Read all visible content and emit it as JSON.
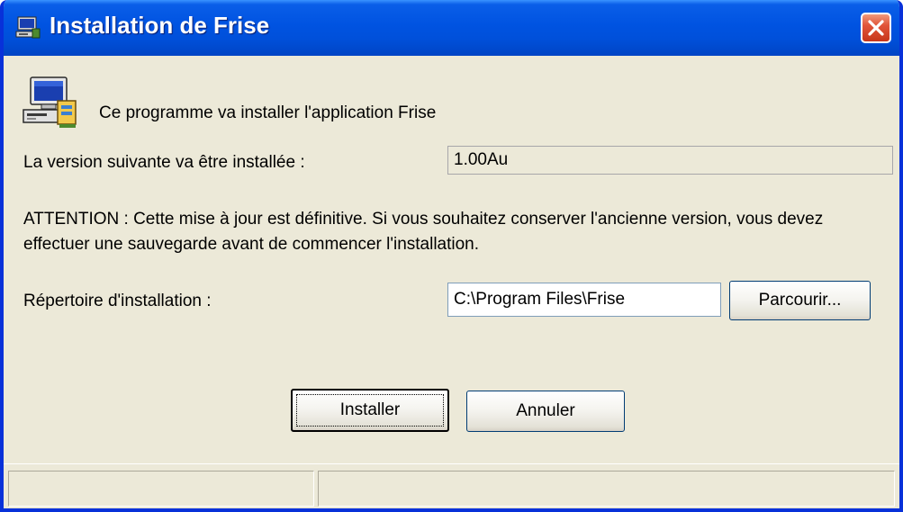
{
  "window": {
    "title": "Installation de Frise",
    "title_icon": "computer-setup-icon",
    "close_icon": "close-icon"
  },
  "content": {
    "app_icon": "computer-install-icon",
    "intro": "Ce programme va installer l'application Frise",
    "version_label": "La version suivante va être installée :",
    "version_value": "1.00Au",
    "attention_text": "ATTENTION : Cette mise à jour est définitive. Si vous souhaitez conserver l'ancienne version, vous devez effectuer une sauvegarde avant de commencer l'installation.",
    "directory_label": "Répertoire d'installation :",
    "directory_value": "C:\\Program Files\\Frise",
    "browse_label": "Parcourir...",
    "install_label": "Installer",
    "cancel_label": "Annuler"
  },
  "statusbar": {
    "pane1": "",
    "pane2": ""
  },
  "colors": {
    "titlebar": "#0053E1",
    "window_frame": "#0831D9",
    "dialog_background": "#ECE9D8",
    "close_button": "#E1553A"
  }
}
